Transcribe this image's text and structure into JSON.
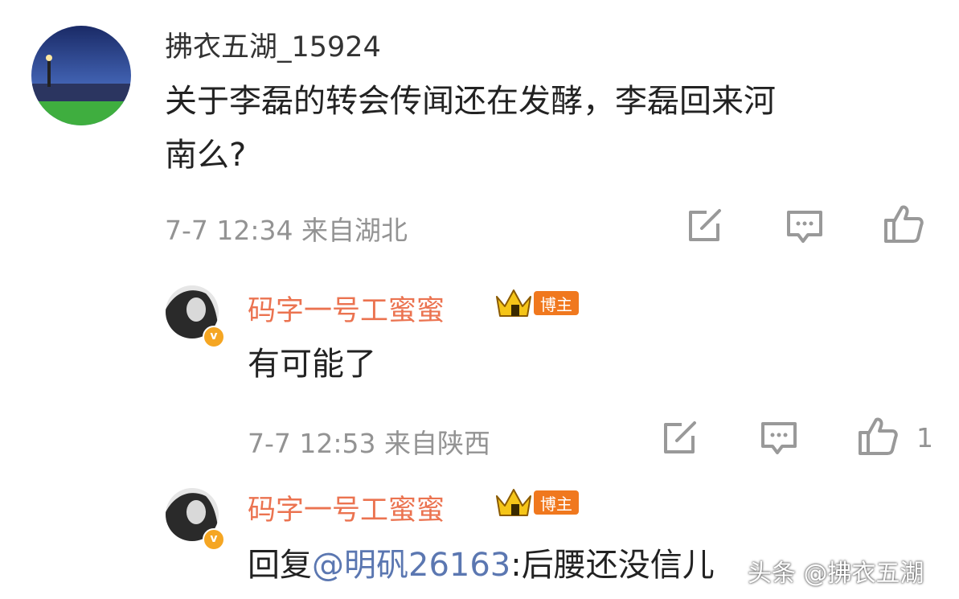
{
  "comment": {
    "username": "拂衣五湖_15924",
    "text_line1": "关于李磊的转会传闻还在发酵，李磊回来河",
    "text_line2": "南么?",
    "time": "7-7 12:34",
    "location": "来自湖北"
  },
  "replies": [
    {
      "username": "码字一号工蜜蜜",
      "badge": "博主",
      "text": "有可能了",
      "time": "7-7 12:53",
      "location": "来自陕西",
      "like_count": "1"
    },
    {
      "username": "码字一号工蜜蜜",
      "badge": "博主",
      "reply_prefix": "回复",
      "mention": "@明矾26163",
      "text": ":后腰还没信儿"
    }
  ],
  "watermark": {
    "brand": "头条",
    "handle": "@拂衣五湖"
  },
  "icons": {
    "repost": "repost-icon",
    "comment": "comment-icon",
    "like": "thumbs-up-icon",
    "crown": "crown-icon",
    "verified": "verified-icon"
  },
  "colors": {
    "reply_name": "#eb7350",
    "mention": "#5b77b1",
    "meta": "#939393",
    "badge": "#f0781e"
  }
}
